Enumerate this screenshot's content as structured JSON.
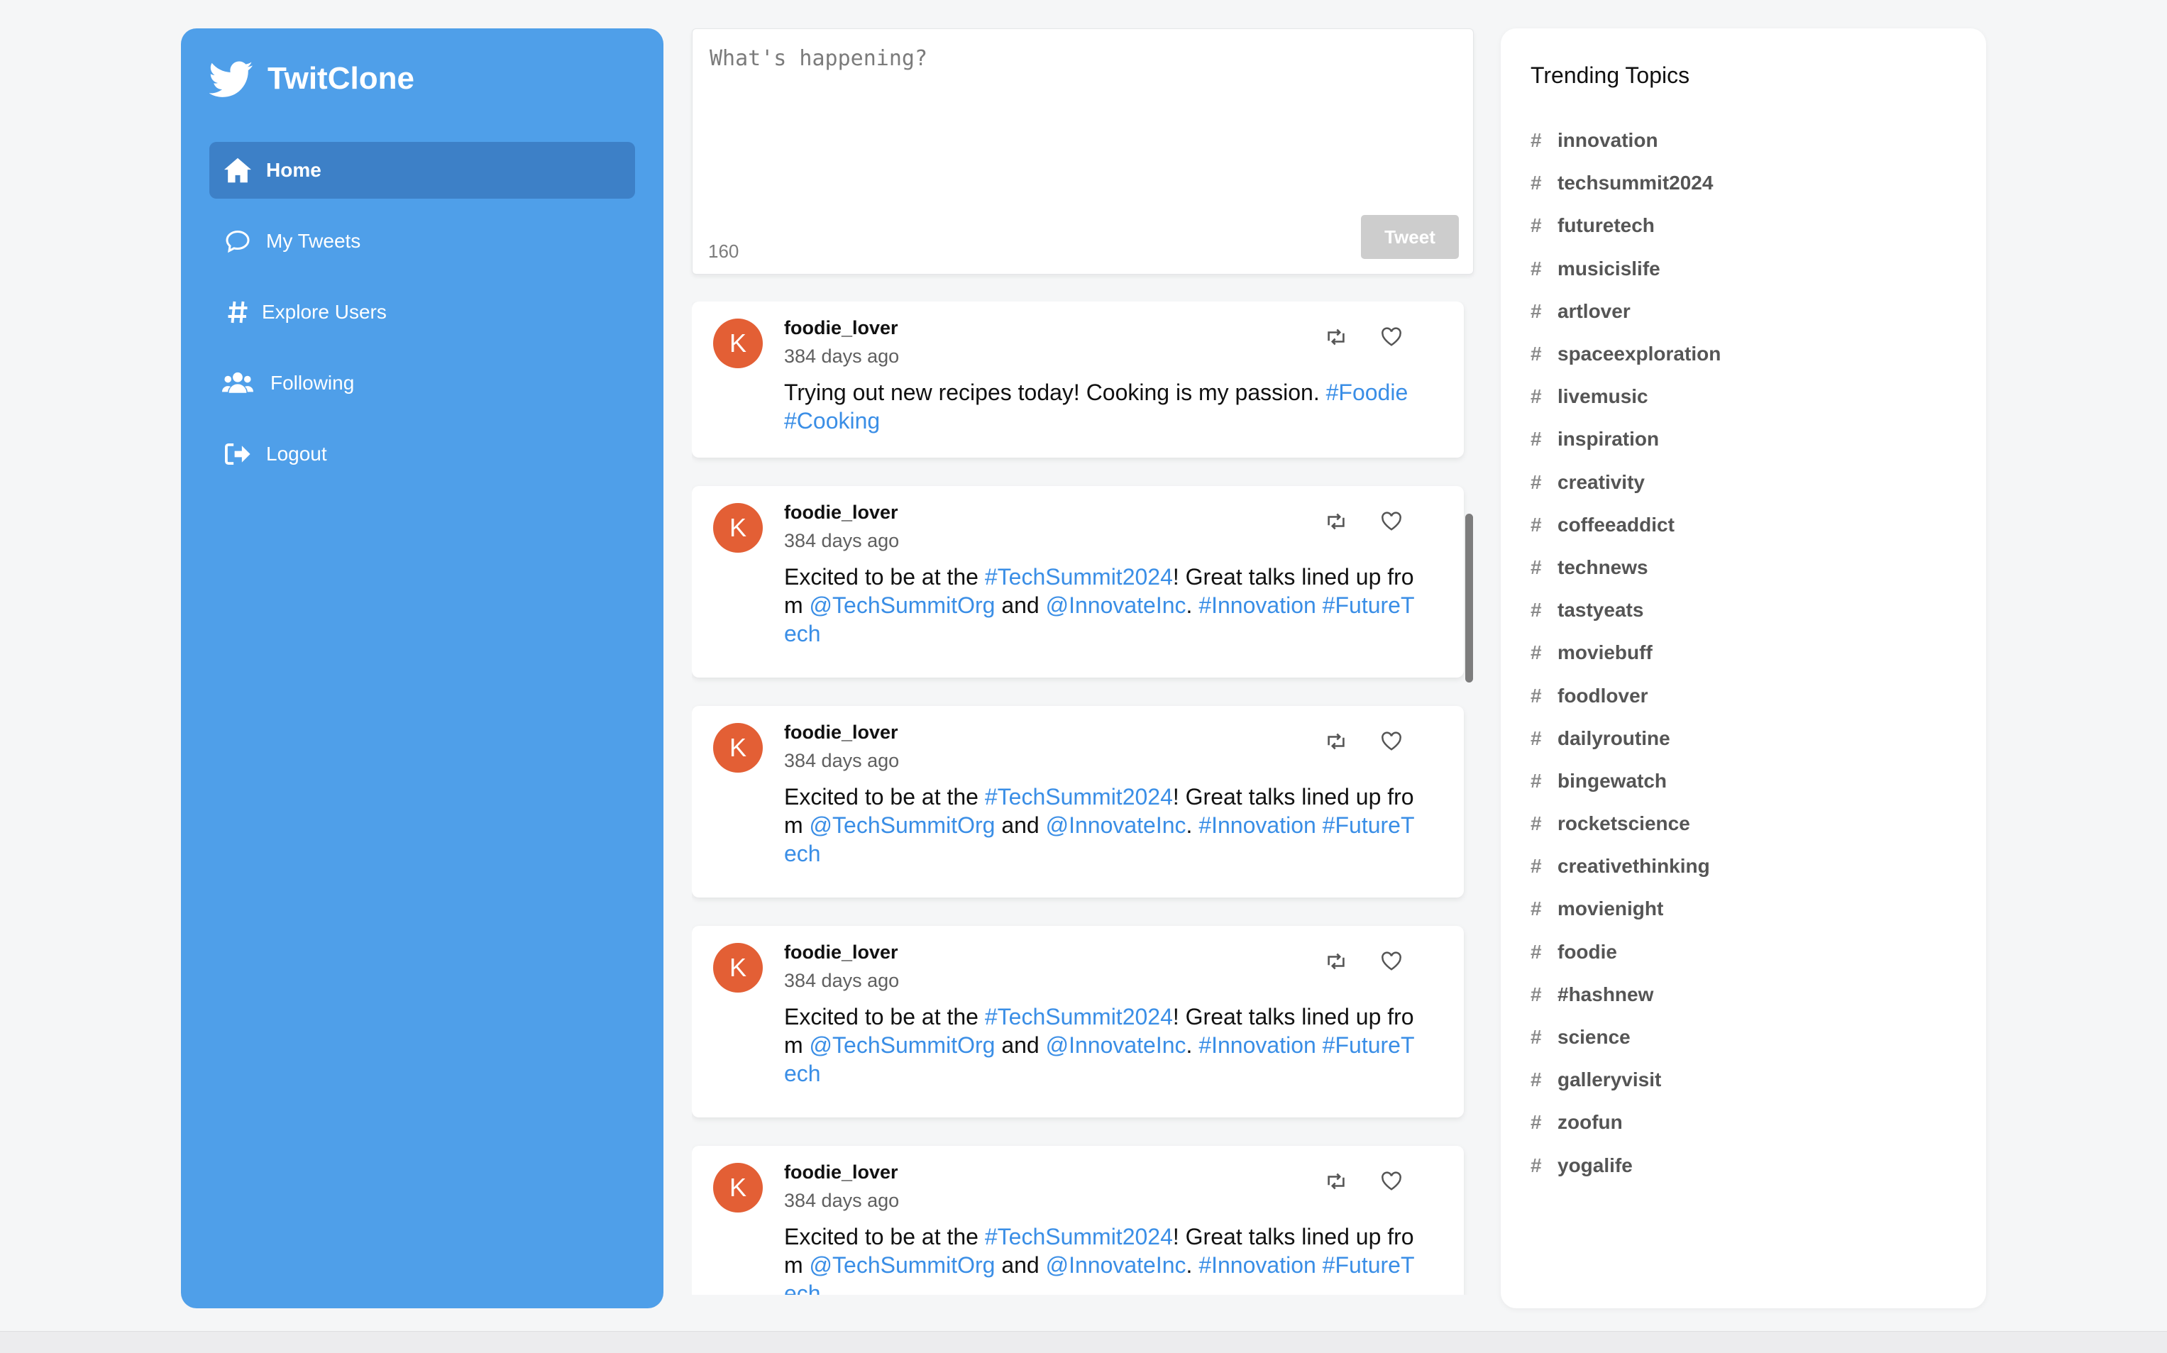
{
  "app": {
    "name": "TwitClone"
  },
  "nav": {
    "items": [
      {
        "label": "Home",
        "icon": "home-icon",
        "active": true
      },
      {
        "label": "My Tweets",
        "icon": "comment-icon",
        "active": false
      },
      {
        "label": "Explore Users",
        "icon": "hashtag-icon",
        "active": false
      },
      {
        "label": "Following",
        "icon": "users-icon",
        "active": false
      },
      {
        "label": "Logout",
        "icon": "logout-icon",
        "active": false
      }
    ]
  },
  "composer": {
    "placeholder": "What's happening?",
    "char_count": "160",
    "tweet_label": "Tweet"
  },
  "tweets": [
    {
      "avatar": "K",
      "user": "foodie_lover",
      "time": "384 days ago",
      "segments": [
        {
          "text": "Trying out new recipes today! Cooking is my passion. "
        },
        {
          "text": "#Foodie",
          "link": true
        },
        {
          "text": " "
        },
        {
          "text": "#Cooking",
          "link": true
        }
      ]
    },
    {
      "avatar": "K",
      "user": "foodie_lover",
      "time": "384 days ago",
      "segments": [
        {
          "text": "Excited to be at the "
        },
        {
          "text": "#TechSummit2024",
          "link": true
        },
        {
          "text": "! Great talks lined up from "
        },
        {
          "text": "@TechSummitOrg",
          "link": true
        },
        {
          "text": " and "
        },
        {
          "text": "@InnovateInc",
          "link": true
        },
        {
          "text": ". "
        },
        {
          "text": "#Innovation",
          "link": true
        },
        {
          "text": " "
        },
        {
          "text": "#FutureTech",
          "link": true
        }
      ]
    },
    {
      "avatar": "K",
      "user": "foodie_lover",
      "time": "384 days ago",
      "segments": [
        {
          "text": "Excited to be at the "
        },
        {
          "text": "#TechSummit2024",
          "link": true
        },
        {
          "text": "! Great talks lined up from "
        },
        {
          "text": "@TechSummitOrg",
          "link": true
        },
        {
          "text": " and "
        },
        {
          "text": "@InnovateInc",
          "link": true
        },
        {
          "text": ". "
        },
        {
          "text": "#Innovation",
          "link": true
        },
        {
          "text": " "
        },
        {
          "text": "#FutureTech",
          "link": true
        }
      ]
    },
    {
      "avatar": "K",
      "user": "foodie_lover",
      "time": "384 days ago",
      "segments": [
        {
          "text": "Excited to be at the "
        },
        {
          "text": "#TechSummit2024",
          "link": true
        },
        {
          "text": "! Great talks lined up from "
        },
        {
          "text": "@TechSummitOrg",
          "link": true
        },
        {
          "text": " and "
        },
        {
          "text": "@InnovateInc",
          "link": true
        },
        {
          "text": ". "
        },
        {
          "text": "#Innovation",
          "link": true
        },
        {
          "text": " "
        },
        {
          "text": "#FutureTech",
          "link": true
        }
      ]
    },
    {
      "avatar": "K",
      "user": "foodie_lover",
      "time": "384 days ago",
      "segments": [
        {
          "text": "Excited to be at the "
        },
        {
          "text": "#TechSummit2024",
          "link": true
        },
        {
          "text": "! Great talks lined up from "
        },
        {
          "text": "@TechSummitOrg",
          "link": true
        },
        {
          "text": " and "
        },
        {
          "text": "@InnovateInc",
          "link": true
        },
        {
          "text": ". "
        },
        {
          "text": "#Innovation",
          "link": true
        },
        {
          "text": " "
        },
        {
          "text": "#FutureTech",
          "link": true
        }
      ]
    }
  ],
  "trending": {
    "title": "Trending Topics",
    "hash_symbol": "#",
    "topics": [
      "innovation",
      "techsummit2024",
      "futuretech",
      "musicislife",
      "artlover",
      "spaceexploration",
      "livemusic",
      "inspiration",
      "creativity",
      "coffeeaddict",
      "technews",
      "tastyeats",
      "moviebuff",
      "foodlover",
      "dailyroutine",
      "bingewatch",
      "rocketscience",
      "creativethinking",
      "movienight",
      "foodie",
      "#hashnew",
      "science",
      "galleryvisit",
      "zoofun",
      "yogalife"
    ]
  },
  "colors": {
    "sidebar": "#4f9fe9",
    "sidebar_active": "#3d80c7",
    "link": "#3a8ee6",
    "avatar": "#e35f35",
    "tweet_button_disabled": "#cdcdcd"
  }
}
